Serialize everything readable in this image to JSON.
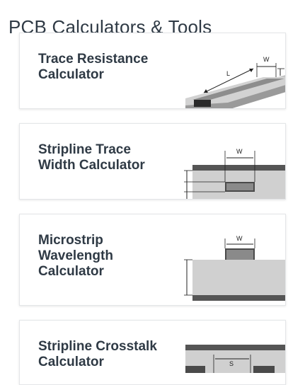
{
  "page": {
    "title": "PCB Calculators & Tools"
  },
  "cards": [
    {
      "title_line1": "Trace Resistance",
      "title_line2": "Calculator",
      "title_line3": "",
      "dims": [
        "W",
        "L",
        "T"
      ]
    },
    {
      "title_line1": "Stripline Trace",
      "title_line2": "Width Calculator",
      "title_line3": "",
      "dims": [
        "W"
      ]
    },
    {
      "title_line1": "Microstrip",
      "title_line2": "Wavelength",
      "title_line3": "Calculator",
      "dims": [
        "W"
      ]
    },
    {
      "title_line1": "Stripline Crosstalk",
      "title_line2": "Calculator",
      "title_line3": "",
      "dims": [
        "S"
      ]
    }
  ],
  "colors": {
    "title": "#2f3a45",
    "diagram_fill": "#cccccc",
    "diagram_dark": "#4a4a4a",
    "diagram_mid": "#8a8a8a"
  }
}
